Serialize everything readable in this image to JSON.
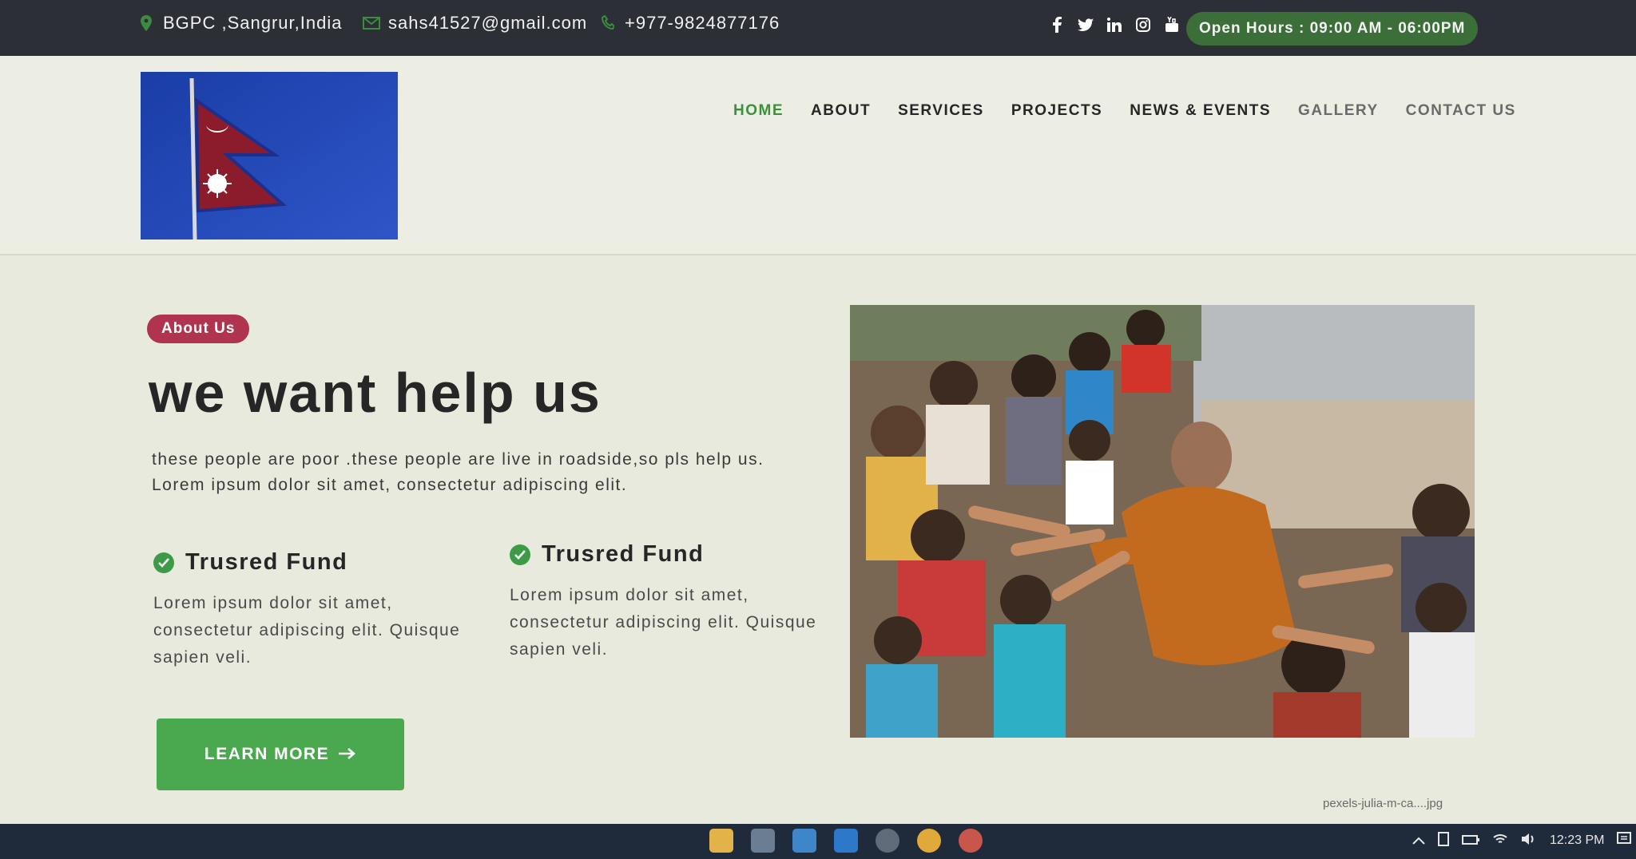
{
  "topbar": {
    "location": "BGPC ,Sangrur,India",
    "email": "sahs41527@gmail.com",
    "phone": "+977-9824877176",
    "socials": [
      "facebook-icon",
      "twitter-icon",
      "linkedin-icon",
      "instagram-icon",
      "youtube-icon"
    ],
    "hours": "Open Hours : 09:00 AM - 06:00PM"
  },
  "nav": {
    "items": [
      "HOME",
      "ABOUT",
      "SERVICES",
      "PROJECTS",
      "NEWS & EVENTS",
      "GALLERY",
      "CONTACT US"
    ],
    "active": "HOME"
  },
  "about": {
    "badge": "About Us",
    "headline": "we want help us",
    "intro_line1": "these people are poor .these people are live in roadside,so pls help us.",
    "intro_line2": "Lorem ipsum dolor sit amet, consectetur adipiscing elit.",
    "features": [
      {
        "title": "Trusred Fund",
        "text": "Lorem ipsum dolor sit amet, consectetur adipiscing elit. Quisque sapien veli."
      },
      {
        "title": "Trusred Fund",
        "text": "Lorem ipsum dolor sit amet, consectetur adipiscing elit. Quisque sapien veli."
      }
    ],
    "button": "Learn More"
  },
  "status": {
    "filename": "pexels-julia-m-ca....jpg",
    "time": "12:23 PM"
  },
  "colors": {
    "topbar_bg": "#2c3036",
    "accent_green": "#4aa94f",
    "badge": "#b0334f",
    "nav_active": "#3d8f3d"
  }
}
